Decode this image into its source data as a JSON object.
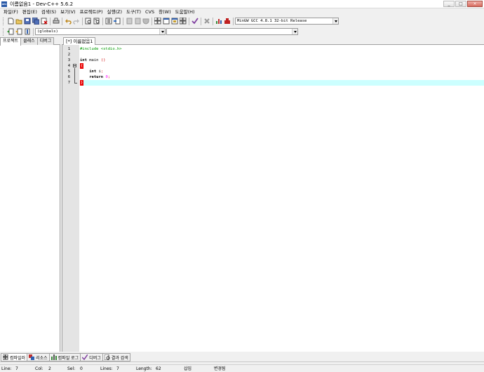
{
  "window": {
    "title": "이름없음1 - Dev-C++ 5.6.2",
    "icon_text": "DEV"
  },
  "menu": [
    "파일(F)",
    "편집(E)",
    "검색(S)",
    "보기(V)",
    "프로젝트(P)",
    "실행(Z)",
    "도구(T)",
    "CVS",
    "창(W)",
    "도움말(H)"
  ],
  "toolbar": {
    "compiler_select": "MinGW GCC 4.8.1 32-bit Release",
    "scope_select": "(globals)",
    "member_select": ""
  },
  "left_tabs": [
    "프로젝트",
    "클래스",
    "디버그"
  ],
  "editor_tab": "[*] 이름없음1",
  "code": {
    "line_numbers": [
      "1",
      "2",
      "3",
      "4",
      "5",
      "6",
      "7"
    ],
    "include_line": "#include <stdio.h>",
    "main_kw": "int",
    "main_name": " main ",
    "main_parens": "()",
    "open_brace": "{",
    "int_kw": "int",
    "var_decl": " i",
    "semi": ";",
    "return_kw": "return",
    "return_val": "0",
    "close_brace": "}"
  },
  "bottom_tabs": [
    "컴파일러",
    "리소스",
    "컴파일 로그",
    "디버그",
    "결과 검색"
  ],
  "status": {
    "line_label": "Line:",
    "line_value": "7",
    "col_label": "Col:",
    "col_value": "2",
    "sel_label": "Sel:",
    "sel_value": "0",
    "lines_label": "Lines:",
    "lines_value": "7",
    "length_label": "Length:",
    "length_value": "62",
    "insert_mode": "삽입",
    "modified": "변경됨"
  }
}
